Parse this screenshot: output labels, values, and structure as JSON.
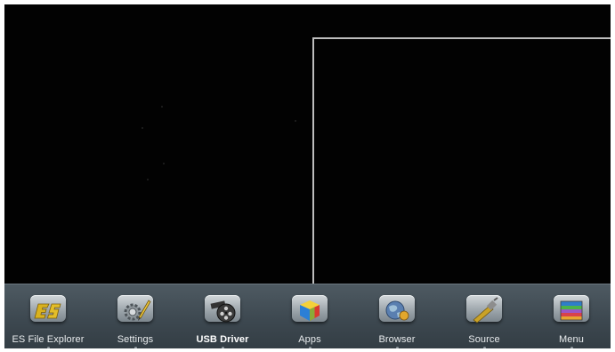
{
  "taskbar": {
    "items": [
      {
        "label": "ES File Explorer",
        "icon": "es-file-explorer-icon"
      },
      {
        "label": "Settings",
        "icon": "settings-gear-icon"
      },
      {
        "label": "USB Driver",
        "icon": "usb-driver-film-reel-icon",
        "active": true
      },
      {
        "label": "Apps",
        "icon": "apps-cube-icon"
      },
      {
        "label": "Browser",
        "icon": "browser-globe-icon"
      },
      {
        "label": "Source",
        "icon": "source-cable-icon"
      },
      {
        "label": "Menu",
        "icon": "menu-book-icon"
      }
    ]
  },
  "colors": {
    "screen_background": "#000000",
    "taskbar_background": "#3d4850",
    "frame_line": "#bdbdbd"
  }
}
